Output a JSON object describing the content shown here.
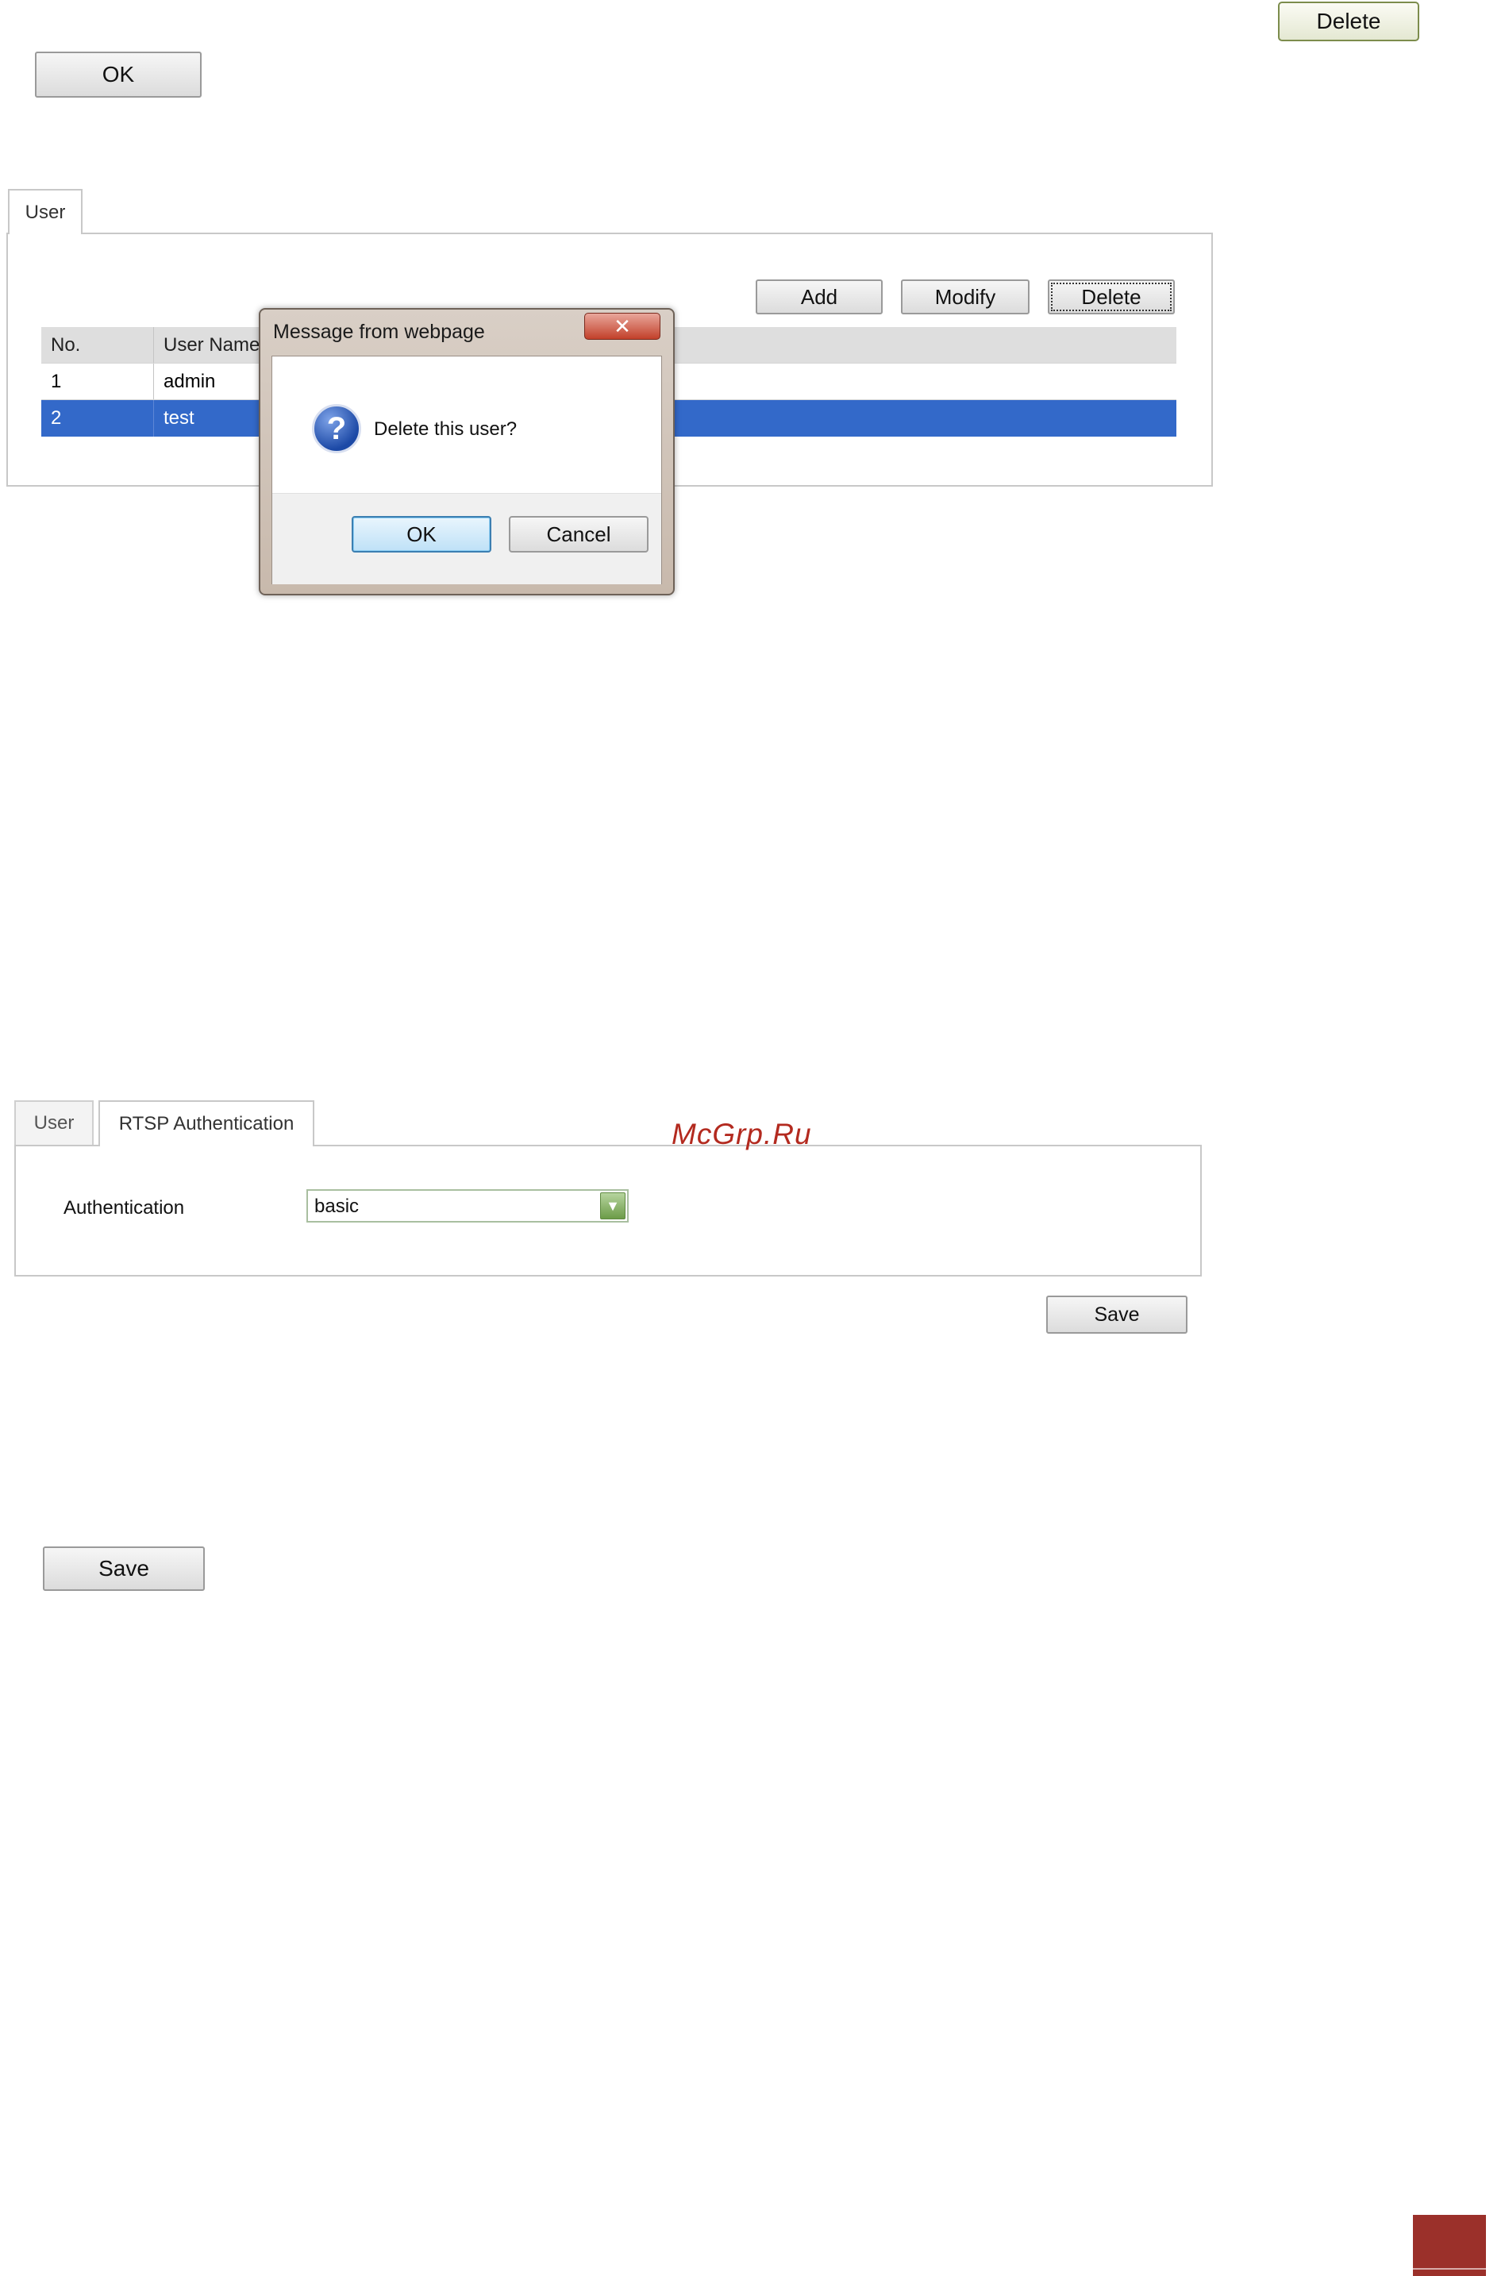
{
  "top_buttons": {
    "delete_label": "Delete",
    "ok_label": "OK"
  },
  "user_list": {
    "tab_label": "User",
    "actions": {
      "add": "Add",
      "modify": "Modify",
      "delete": "Delete"
    },
    "columns": [
      "No.",
      "User Name"
    ],
    "rows": [
      {
        "no": "1",
        "name": "admin",
        "selected": false
      },
      {
        "no": "2",
        "name": "test",
        "selected": true
      }
    ]
  },
  "dialog": {
    "title": "Message from webpage",
    "close_glyph": "✕",
    "icon": "question-icon",
    "message": "Delete this user?",
    "ok_label": "OK",
    "cancel_label": "Cancel"
  },
  "rtsp": {
    "tabs": [
      "User",
      "RTSP Authentication"
    ],
    "auth_label": "Authentication",
    "auth_value": "basic",
    "save_label": "Save"
  },
  "watermark": "McGrp.Ru",
  "bottom": {
    "save_label": "Save"
  },
  "colors": {
    "selection": "#3369c9",
    "corner_tab": "#9b302a",
    "watermark": "#b32a1f"
  }
}
